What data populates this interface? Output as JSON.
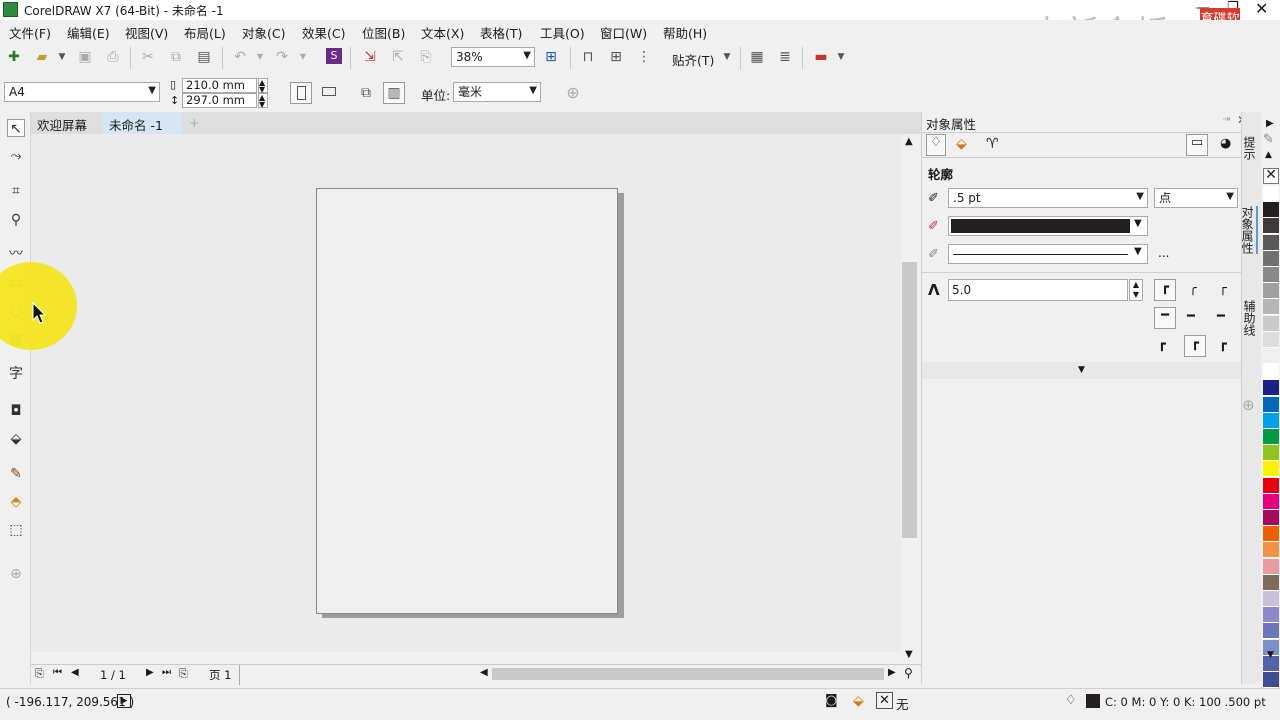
{
  "window": {
    "title": "CorelDRAW X7 (64-Bit) - 未命名 -1"
  },
  "watermark": {
    "text": "中新金桥",
    "logo_text": "育碟软件"
  },
  "menu": [
    "文件(F)",
    "编辑(E)",
    "视图(V)",
    "布局(L)",
    "对象(C)",
    "效果(C)",
    "位图(B)",
    "文本(X)",
    "表格(T)",
    "工具(O)",
    "窗口(W)",
    "帮助(H)"
  ],
  "toolbar": {
    "zoom": "38%",
    "snap_label": "贴齐(T)"
  },
  "propbar": {
    "page_size": "A4",
    "width": "210.0 mm",
    "height": "297.0 mm",
    "units_label": "单位:",
    "units_value": "毫米"
  },
  "tabs": {
    "welcome": "欢迎屏幕",
    "doc": "未命名 -1"
  },
  "pagenav": {
    "count": "1 / 1",
    "page_tab": "页 1"
  },
  "docker": {
    "title": "对象属性",
    "section": "轮廓",
    "width": ".5 pt",
    "width_unit": "点",
    "style_more": "...",
    "miter": "5.0",
    "colors": {
      "outline": "#231f20"
    }
  },
  "side_tabs": [
    "提示",
    "对象属性",
    "辅助线"
  ],
  "palette": [
    "#ffffff",
    "#231f20",
    "#3e3a39",
    "#595757",
    "#727171",
    "#898989",
    "#9fa0a0",
    "#b5b5b6",
    "#c9caca",
    "#dcdddd",
    "#efefef",
    "#ffffff",
    "#1d2088",
    "#0068b7",
    "#00a0e9",
    "#009944",
    "#8fc31f",
    "#fff100",
    "#e60012",
    "#e4007f",
    "#a40b5d",
    "#eb6100",
    "#f19149",
    "#ea9aa3",
    "#7e6b5a",
    "#c9c1da",
    "#8d86c9",
    "#6b75b8",
    "#7d8ec6",
    "#5662a6",
    "#404d95"
  ],
  "status": {
    "coords": "( -196.117, 209.561 )",
    "fill_label": "无",
    "outline_info": "C: 0 M: 0 Y: 0 K: 100  .500 pt"
  }
}
